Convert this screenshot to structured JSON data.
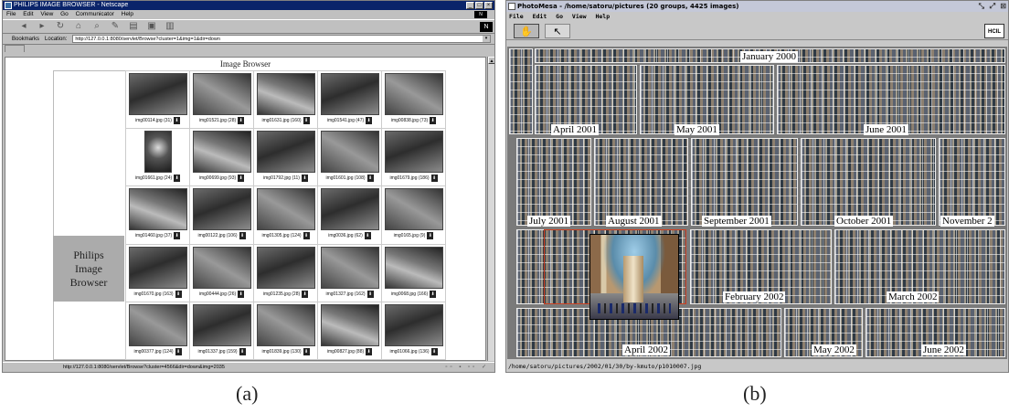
{
  "panel_a": {
    "letter": "(a)",
    "window_title": "PHILIPS IMAGE BROWSER - Netscape",
    "menu": [
      "File",
      "Edit",
      "View",
      "Go",
      "Communicator",
      "Help"
    ],
    "bookmarks_label": "Bookmarks",
    "location_label": "Location:",
    "location_url": "http://127.0.0.1:8080/servlet/Browse?cluster=1&img=1&dir=down",
    "page_title": "Image Browser",
    "brand": [
      "Philips",
      "Image",
      "Browser"
    ],
    "status_url": "http://127.0.0.1:8080/servlet/Browse?cluster=4566&dir=down&img=2035",
    "thumbnails": [
      [
        "img00114.jpg (31)",
        "img01521.jpg (28)",
        "img01631.jpg (160)",
        "img01541.jpg (47)",
        "img00838.jpg (73)"
      ],
      [
        "img01661.jpg (24)",
        "img00699.jpg (93)",
        "img01792.jpg (11)",
        "img01601.jpg (108)",
        "img01679.jpg (186)"
      ],
      [
        "img01460.jpg (37)",
        "img00122.jpg (106)",
        "img01305.jpg (124)",
        "img0036.jpg (62)",
        "img0165.jpg (9)"
      ],
      [
        "img01670.jpg (163)",
        "img00444.jpg (26)",
        "img01235.jpg (28)",
        "img01327.jpg (162)",
        "img0068.jpg (166)"
      ],
      [
        "img00377.jpg (124)",
        "img01337.jpg (159)",
        "img01839.jpg (130)",
        "img00827.jpg (88)",
        "img01066.jpg (136)"
      ]
    ]
  },
  "panel_b": {
    "letter": "(b)",
    "window_title": "PhotoMesa - /home/satoru/pictures (20 groups, 4425 images)",
    "menu": [
      "File",
      "Edit",
      "Go",
      "View",
      "Help"
    ],
    "hcil_label": "HCIL",
    "status_path": "/home/satoru/pictures/2002/01/30/by-kmuto/p1010007.jpg",
    "groups": [
      "January 2000",
      "April 2001",
      "May 2001",
      "June 2001",
      "July 2001",
      "August 2001",
      "September 2001",
      "October 2001",
      "November 2",
      "February 2002",
      "March 2002",
      "April 2002",
      "May 2002",
      "June 2002"
    ]
  }
}
